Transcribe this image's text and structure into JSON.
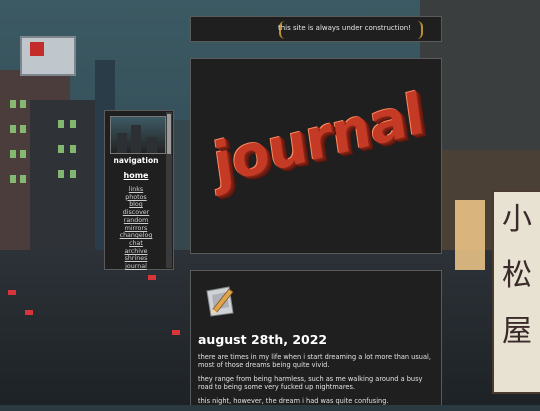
{
  "marquee": {
    "text": "this site is always under construction!"
  },
  "header": {
    "logo_text": "journal"
  },
  "background": {
    "sign_text": [
      "小",
      "松",
      "屋"
    ]
  },
  "nav": {
    "title": "navigation",
    "home": "home",
    "links": [
      "links",
      "photos",
      "blog",
      "discover",
      "random",
      "mirrors",
      "changelog",
      "chat",
      "archive",
      "shrines",
      "journal"
    ]
  },
  "post": {
    "title": "august 28th, 2022",
    "paragraphs": [
      "there are times in my life when i start dreaming a lot more than usual, most of those dreams being quite vivid.",
      "they range from being harmless, such as me walking around a busy road to being some very fucked up nightmares.",
      "this night, however, the dream i had was quite confusing."
    ]
  },
  "colors": {
    "panel_bg": "#1f1f1f",
    "logo_red": "#c43a25",
    "marquee_border": "#b99032"
  },
  "icons": {
    "post_icon": "pencil-paper-icon"
  }
}
